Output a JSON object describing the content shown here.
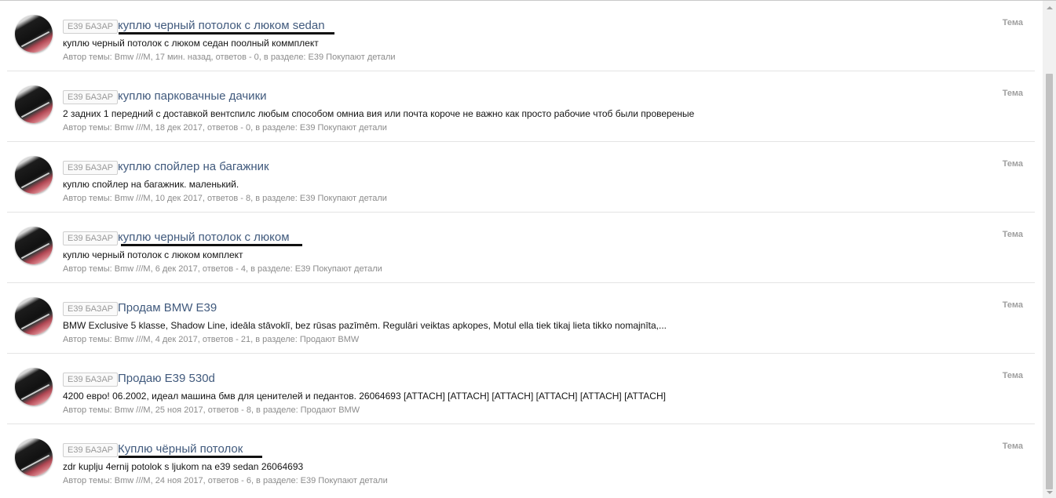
{
  "threads": [
    {
      "prefix": "E39 БАЗАР",
      "title": "куплю черный потолок с люком sedan",
      "snippet": "куплю черный потолок с люком седан поолный коммплект",
      "meta": "Автор темы: Bmw ///M, 17 мин. назад, ответов - 0, в разделе: E39 Покупают детали",
      "type": "Тема"
    },
    {
      "prefix": "E39 БАЗАР",
      "title": "куплю парковачные дачики",
      "snippet": "2 задних 1 передний с доставкой вентспилс любым способом омниа вия или почта короче не важно как просто рабочие чтоб были провереные",
      "meta": "Автор темы: Bmw ///M, 18 дек 2017, ответов - 0, в разделе: E39 Покупают детали",
      "type": "Тема"
    },
    {
      "prefix": "E39 БАЗАР",
      "title": "куплю спойлер на багажник",
      "snippet": "куплю спойлер на багажник. маленький.",
      "meta": "Автор темы: Bmw ///M, 10 дек 2017, ответов - 8, в разделе: E39 Покупают детали",
      "type": "Тема"
    },
    {
      "prefix": "E39 БАЗАР",
      "title": "куплю черный потолок с люком",
      "snippet": "куплю черный потолок с люком комплект",
      "meta": "Автор темы: Bmw ///M, 6 дек 2017, ответов - 4, в разделе: E39 Покупают детали",
      "type": "Тема"
    },
    {
      "prefix": "E39 БАЗАР",
      "title": "Продам BMW E39",
      "snippet": "BMW Exclusive 5 klasse, Shadow Line, ideāla stāvoklī, bez rūsas pazīmēm. Regulāri veiktas apkopes, Motul ella tiek tikaj lieta tikko nomajnīta,...",
      "meta": "Автор темы: Bmw ///M, 4 дек 2017, ответов - 21, в разделе: Продают BMW",
      "type": "Тема"
    },
    {
      "prefix": "E39 БАЗАР",
      "title": "Продаю E39 530d",
      "snippet": "4200 евро! 06.2002, идеал машина бмв для ценителей и педантов. 26064693 [ATTACH] [ATTACH] [ATTACH] [ATTACH] [ATTACH] [ATTACH]",
      "meta": "Автор темы: Bmw ///M, 25 ноя 2017, ответов - 8, в разделе: Продают BMW",
      "type": "Тема"
    },
    {
      "prefix": "E39 БАЗАР",
      "title": "Куплю чёрный потолок",
      "snippet": "zdr kuplju 4ernij potolok s ljukom na e39 sedan 26064693",
      "meta": "Автор темы: Bmw ///M, 24 ноя 2017, ответов - 6, в разделе: E39 Покупают детали",
      "type": "Тема"
    }
  ]
}
